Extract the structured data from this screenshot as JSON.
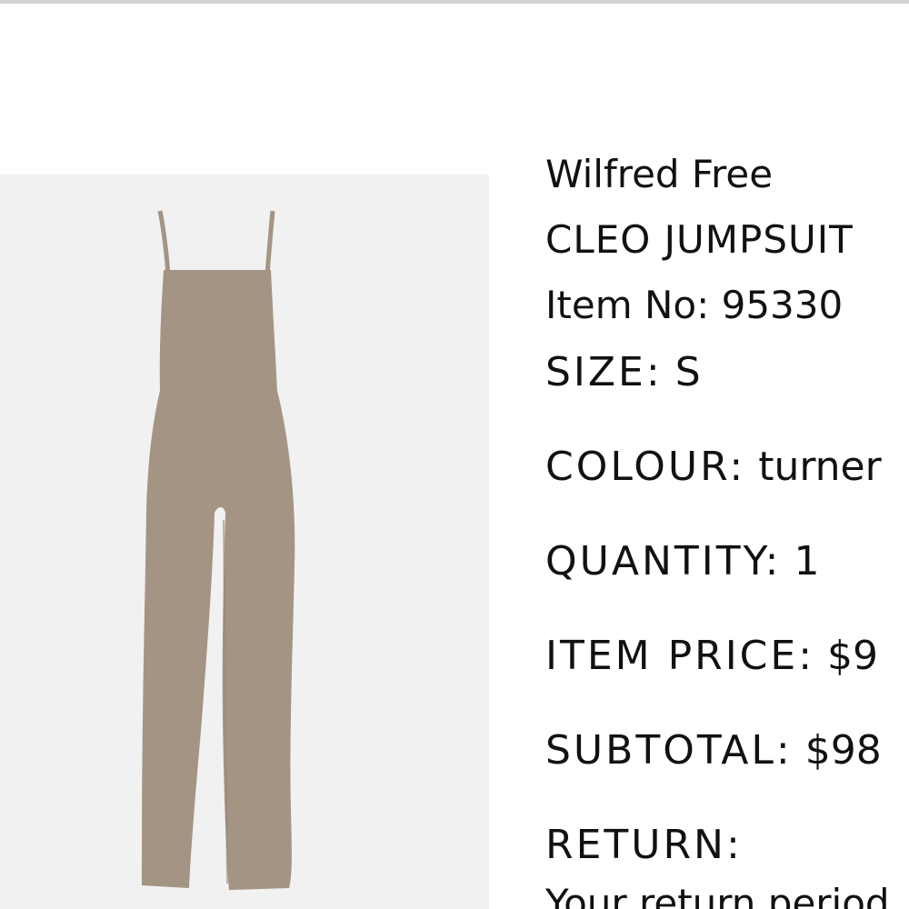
{
  "product": {
    "brand": "Wilfred Free",
    "name": "CLEO JUMPSUIT",
    "item_no_label": "Item No:",
    "item_no": "95330",
    "image_alt": "Cleo jumpsuit in taupe"
  },
  "attributes": {
    "size_label": "SIZE:",
    "size": "S",
    "colour_label": "COLOUR:",
    "colour": "turner",
    "quantity_label": "QUANTITY:",
    "quantity": "1",
    "item_price_label": "ITEM PRICE:",
    "item_price": "$9",
    "subtotal_label": "SUBTOTAL:",
    "subtotal": "$98",
    "return_label": "RETURN:",
    "return_note": "Your return period"
  },
  "colors": {
    "garment": "#a49484",
    "image_background": "#f1f1f1",
    "text": "#111111"
  }
}
